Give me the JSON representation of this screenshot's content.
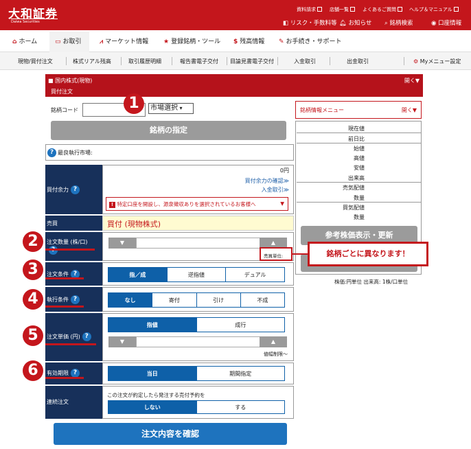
{
  "header": {
    "logo": "大和証券",
    "logo_sub": "Daiwa Securities",
    "top_links": [
      "資料請求",
      "店舗一覧",
      "よくあるご質問",
      "ヘルプ＆マニュアル"
    ],
    "sub_links": [
      "リスク・手数料等",
      "お知らせ",
      "銘柄検索",
      "口座情報"
    ]
  },
  "main_nav": [
    "ホーム",
    "お取引",
    "マーケット情報",
    "登録銘柄・ツール",
    "残高情報",
    "お手続き・サポート"
  ],
  "sub_nav": [
    "現物/買付注文",
    "株式リアル残高",
    "取引履歴明細",
    "報告書電子交付",
    "目論見書電子交付",
    "入金取引",
    "出金取引",
    "Myメニュー設定"
  ],
  "panel": {
    "category": "国内株式(現物)",
    "subtitle": "買付注文",
    "open_label": "開く▼"
  },
  "ticker": {
    "label": "銘柄コード",
    "market_select": "市場選択",
    "specify_button": "銘柄の指定",
    "best_market": "最良執行市場:"
  },
  "buying_power": {
    "label": "買付余力",
    "amount": "0円",
    "check_link": "買付余力の確認≫",
    "deposit_link": "入金取引≫",
    "notice": "特定口座を開設し、源泉徴収ありを選択されているお客様へ"
  },
  "trade": {
    "label": "売買",
    "value": "買付 (現物株式)"
  },
  "quantity": {
    "label": "注文数量 (株/口)",
    "unit_label": "売買単位:"
  },
  "order_condition": {
    "label": "注文条件",
    "options": [
      "指／成",
      "逆指値",
      "デュアル"
    ],
    "selected": 0
  },
  "exec_condition": {
    "label": "執行条件",
    "options": [
      "なし",
      "寄付",
      "引け",
      "不成"
    ],
    "selected": 0
  },
  "price": {
    "label": "注文単価 (円)",
    "options": [
      "指値",
      "成行"
    ],
    "selected": 0,
    "limit_label": "値幅制限～"
  },
  "expiry": {
    "label": "有効期限",
    "options": [
      "当日",
      "期間指定"
    ],
    "selected": 0
  },
  "continuous": {
    "label": "連続注文",
    "text": "この注文が約定したら発注する売付予約を",
    "options": [
      "しない",
      "する"
    ],
    "selected": 0
  },
  "confirm_button": "注文内容を確認",
  "stock_info": {
    "menu_label": "銘柄情報メニュー",
    "open_label": "開く▼",
    "rows": [
      "現在値",
      "前日比",
      "始値",
      "高値",
      "安値",
      "出来高",
      "売気配値",
      "数量",
      "買気配値",
      "数量"
    ],
    "quote_button": "参考株価表示・更新",
    "unit_note": "株価:円単位  出来高: 1株/口単位"
  },
  "callout": "銘柄ごとに異なります！",
  "step_numbers": [
    "1",
    "2",
    "3",
    "4",
    "5",
    "6"
  ],
  "colors": {
    "brand": "#c4161c",
    "navy": "#17305a",
    "blue": "#0e60a8"
  }
}
